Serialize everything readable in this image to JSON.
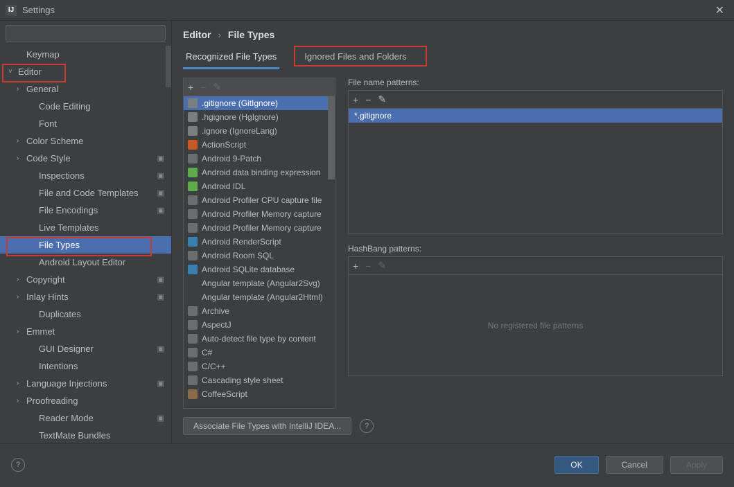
{
  "window": {
    "title": "Settings"
  },
  "breadcrumb": {
    "root": "Editor",
    "leaf": "File Types"
  },
  "tabs": [
    {
      "label": "Recognized File Types",
      "active": true
    },
    {
      "label": "Ignored Files and Folders",
      "active": false
    }
  ],
  "sidebar": {
    "items": [
      {
        "label": "Keymap",
        "level": 1,
        "expandable": false
      },
      {
        "label": "Editor",
        "level": 0,
        "expandable": true,
        "expanded": true,
        "redbox": true
      },
      {
        "label": "General",
        "level": 1,
        "expandable": true
      },
      {
        "label": "Code Editing",
        "level": 2
      },
      {
        "label": "Font",
        "level": 2
      },
      {
        "label": "Color Scheme",
        "level": 1,
        "expandable": true
      },
      {
        "label": "Code Style",
        "level": 1,
        "expandable": true,
        "gear": true
      },
      {
        "label": "Inspections",
        "level": 2,
        "gear": true
      },
      {
        "label": "File and Code Templates",
        "level": 2,
        "gear": true
      },
      {
        "label": "File Encodings",
        "level": 2,
        "gear": true
      },
      {
        "label": "Live Templates",
        "level": 2
      },
      {
        "label": "File Types",
        "level": 2,
        "selected": true,
        "redbox": true
      },
      {
        "label": "Android Layout Editor",
        "level": 2
      },
      {
        "label": "Copyright",
        "level": 1,
        "expandable": true,
        "gear": true
      },
      {
        "label": "Inlay Hints",
        "level": 1,
        "expandable": true,
        "gear": true
      },
      {
        "label": "Duplicates",
        "level": 2
      },
      {
        "label": "Emmet",
        "level": 1,
        "expandable": true
      },
      {
        "label": "GUI Designer",
        "level": 2,
        "gear": true
      },
      {
        "label": "Intentions",
        "level": 2
      },
      {
        "label": "Language Injections",
        "level": 1,
        "expandable": true,
        "gear": true
      },
      {
        "label": "Proofreading",
        "level": 1,
        "expandable": true
      },
      {
        "label": "Reader Mode",
        "level": 2,
        "gear": true
      },
      {
        "label": "TextMate Bundles",
        "level": 2
      }
    ]
  },
  "fileTypes": [
    {
      "label": ".gitignore (GitIgnore)",
      "selected": true,
      "iconColor": "#7a7e80"
    },
    {
      "label": ".hgignore (HgIgnore)",
      "iconColor": "#7a7e80"
    },
    {
      "label": ".ignore (IgnoreLang)",
      "iconColor": "#7a7e80"
    },
    {
      "label": "ActionScript",
      "iconColor": "#c75a22"
    },
    {
      "label": "Android 9-Patch",
      "iconColor": "#6a6d6f"
    },
    {
      "label": "Android data binding expression",
      "iconColor": "#5faa4c"
    },
    {
      "label": "Android IDL",
      "iconColor": "#5faa4c"
    },
    {
      "label": "Android Profiler CPU capture file",
      "iconColor": "#6a6d6f"
    },
    {
      "label": "Android Profiler Memory capture",
      "iconColor": "#6a6d6f"
    },
    {
      "label": "Android Profiler Memory capture",
      "iconColor": "#6a6d6f"
    },
    {
      "label": "Android RenderScript",
      "iconColor": "#3a7fb0"
    },
    {
      "label": "Android Room SQL",
      "iconColor": "#6a6d6f"
    },
    {
      "label": "Android SQLite database",
      "iconColor": "#3a7fb0"
    },
    {
      "label": "Angular template (Angular2Svg)",
      "iconColor": "transparent"
    },
    {
      "label": "Angular template (Angular2Html)",
      "iconColor": "transparent"
    },
    {
      "label": "Archive",
      "iconColor": "#6a6d6f"
    },
    {
      "label": "AspectJ",
      "iconColor": "#6a6d6f"
    },
    {
      "label": "Auto-detect file type by content",
      "iconColor": "#6a6d6f"
    },
    {
      "label": "C#",
      "iconColor": "#6a6d6f"
    },
    {
      "label": "C/C++",
      "iconColor": "#6a6d6f"
    },
    {
      "label": "Cascading style sheet",
      "iconColor": "#6a6d6f"
    },
    {
      "label": "CoffeeScript",
      "iconColor": "#8a6a4a"
    }
  ],
  "fileNamePatterns": {
    "label": "File name patterns:",
    "items": [
      {
        "label": "*.gitignore",
        "selected": true
      }
    ]
  },
  "hashBangPatterns": {
    "label": "HashBang patterns:",
    "empty": "No registered file patterns"
  },
  "associateButton": "Associate File Types with IntelliJ IDEA...",
  "footer": {
    "ok": "OK",
    "cancel": "Cancel",
    "apply": "Apply"
  }
}
